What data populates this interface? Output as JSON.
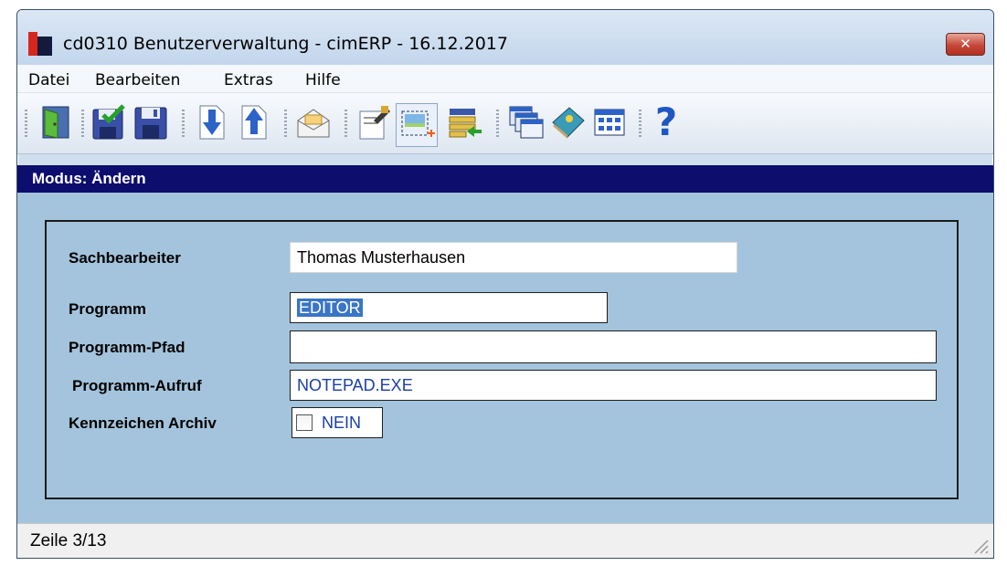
{
  "window": {
    "title": "cd0310 Benutzerverwaltung - cimERP - 16.12.2017",
    "close_label": "✕"
  },
  "menu": [
    "Datei",
    "Bearbeiten",
    "Extras",
    "Hilfe"
  ],
  "toolbar": {
    "icons": [
      "exit-door-icon",
      "save-check-icon",
      "save-icon",
      "arrow-down-icon",
      "arrow-up-icon",
      "envelope-icon",
      "edit-document-icon",
      "new-record-icon",
      "list-transfer-icon",
      "windows-icon",
      "book-icon",
      "table-grid-icon",
      "help-icon"
    ],
    "help_glyph": "?"
  },
  "mode": "Modus: Ändern",
  "form": {
    "sachbearbeiter": {
      "label": "Sachbearbeiter",
      "value": "Thomas Musterhausen"
    },
    "programm": {
      "label": "Programm",
      "value": "EDITOR"
    },
    "programm_pfad": {
      "label": "Programm-Pfad",
      "value": ""
    },
    "programm_aufruf": {
      "label": "Programm-Aufruf",
      "value": "NOTEPAD.EXE"
    },
    "kennzeichen_archiv": {
      "label": "Kennzeichen Archiv",
      "checked": false,
      "value_text": "NEIN"
    }
  },
  "status": "Zeile 3/13",
  "colors": {
    "mode_bar": "#0d0d6e",
    "content_bg": "#a3c4dc",
    "selection": "#3975c6",
    "field_text_blue": "#1a3fa8"
  }
}
